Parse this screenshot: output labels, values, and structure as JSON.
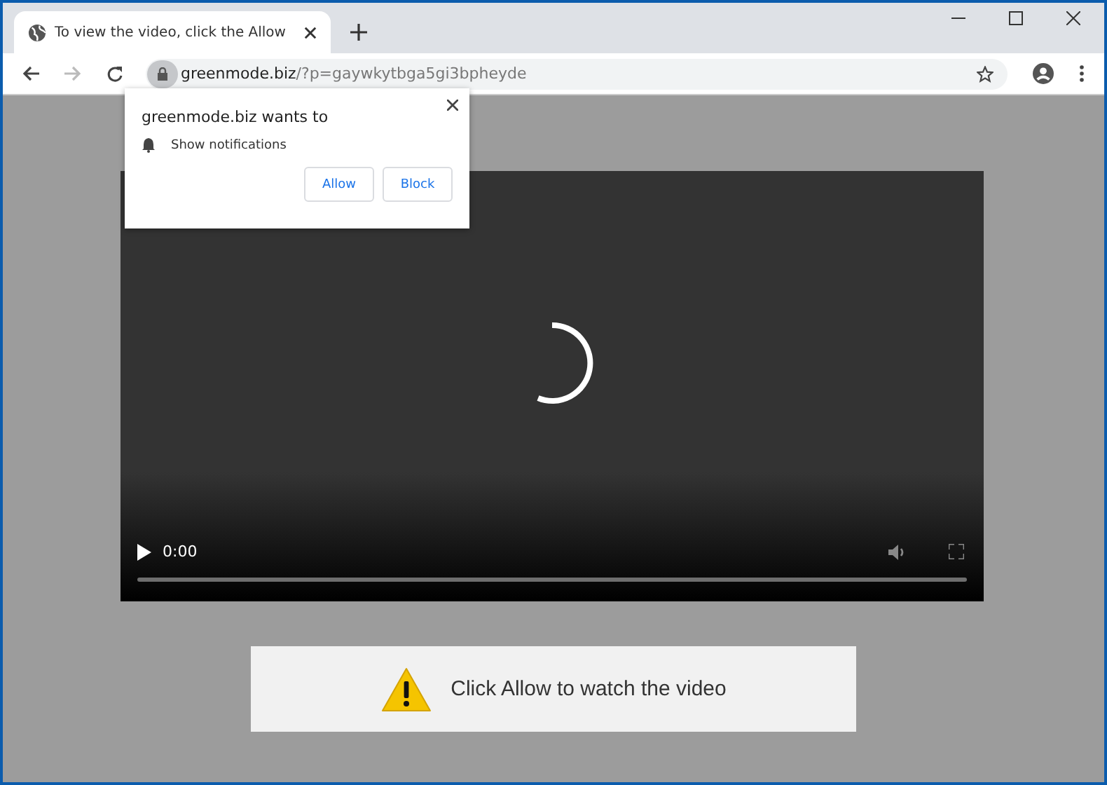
{
  "tab": {
    "title": "To view the video, click the Allow",
    "selected": true
  },
  "address_bar": {
    "domain": "greenmode.biz",
    "path": "/?p=gaywkytbga5gi3bpheyde"
  },
  "permission_popup": {
    "title": "greenmode.biz wants to",
    "permission": "Show notifications",
    "buttons": [
      "Allow",
      "Block"
    ]
  },
  "video_player": {
    "time": "0:00"
  },
  "message": {
    "text": "Click Allow to watch the video"
  }
}
